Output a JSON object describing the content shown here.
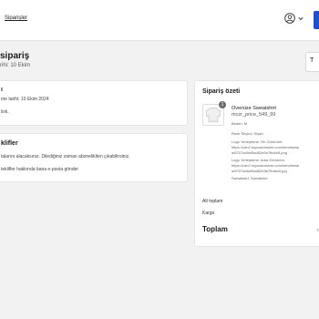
{
  "header": {
    "nav_link": "Siparişler"
  },
  "page": {
    "title": "sipariş",
    "subtitle": "rihi: 10 Ekim",
    "right_button": "T"
  },
  "card_details": {
    "heading": "ı",
    "line1": "me tarihi: 10 Ekim 2024",
    "line2": "lisk."
  },
  "card_offers": {
    "heading": "klifler",
    "line1": "talarını alacaksınız. Dilediğiniz zaman aboneliklten çıkabilirsiniz.",
    "line2": "teklifler hakkında bana e-posta gönder"
  },
  "summary": {
    "heading": "Sipariş özeti",
    "item": {
      "quantity": "1",
      "title": "Oversize Sweatshirt",
      "sku": "mczr_price_549_99",
      "size": "Beden: M",
      "color": "Renk Seçimi: Siyah",
      "front_label": "Logo Yerleştirme: Ön Görünüm:",
      "front_url1": "https://cdn2.mycustomizer.com/kendinese",
      "front_url2": "a/6707ac6ef5ad52e5b7fbdd4f.png",
      "back_label": "Logo Yerleştirme: Arka Görünüm:",
      "back_url1": "https://cdn2.mycustomizer.com/kendinese",
      "back_url2": "a/6707ae6ef5ad52e5b7fbdec5.jpg",
      "sweatshirt": "Sweatshirt: Sweatshirt"
    },
    "subtotal_label": "Alt toplam",
    "shipping_label": "Kargo",
    "total_label": "Toplam",
    "total_value_edge": "TR"
  },
  "colors": {
    "accent": "#1c4fd2",
    "background": "#f2f2f2",
    "card": "#ffffff"
  },
  "icons": {
    "user": "user-circle-icon",
    "chevron": "chevron-down-icon",
    "product": "sweatshirt-thumbnail-icon"
  }
}
